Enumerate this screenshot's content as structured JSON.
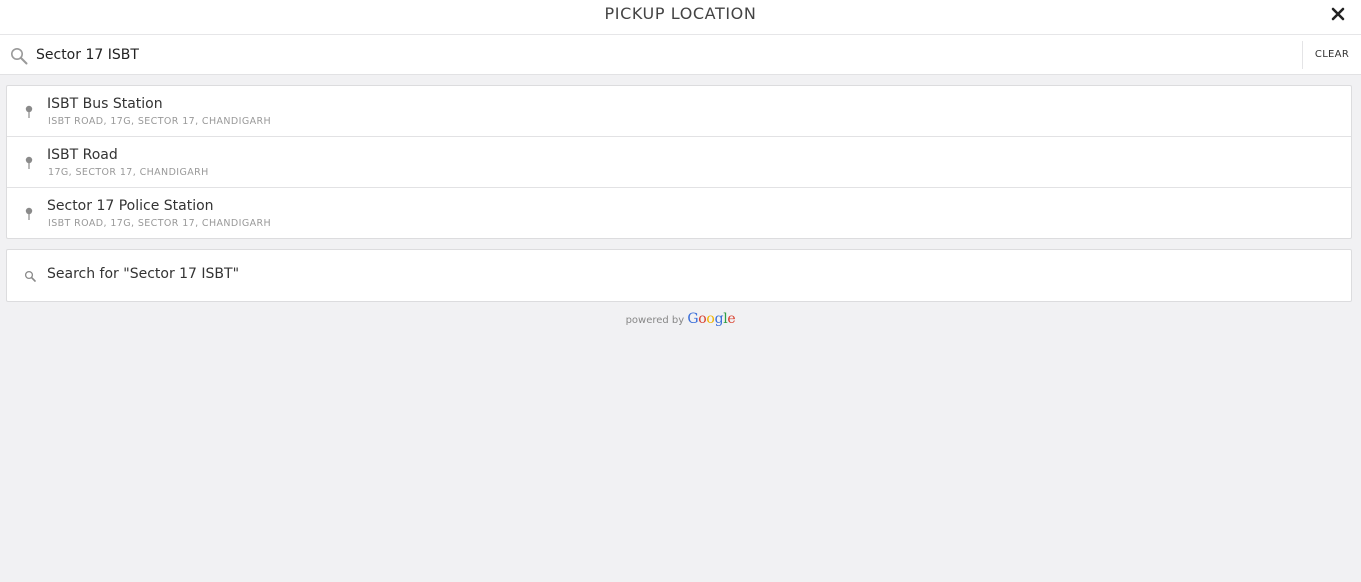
{
  "header": {
    "title": "PICKUP LOCATION",
    "close_icon": "close-icon"
  },
  "search": {
    "value": "Sector 17 ISBT",
    "icon": "search-icon",
    "clear_label": "CLEAR"
  },
  "results": [
    {
      "name": "ISBT Bus Station",
      "address": "ISBT ROAD, 17G, SECTOR 17, CHANDIGARH",
      "icon": "map-pin-icon"
    },
    {
      "name": "ISBT Road",
      "address": "17G, SECTOR 17, CHANDIGARH",
      "icon": "map-pin-icon"
    },
    {
      "name": "Sector 17 Police Station",
      "address": "ISBT ROAD, 17G, SECTOR 17, CHANDIGARH",
      "icon": "map-pin-icon"
    }
  ],
  "search_for": {
    "label": "Search for \"Sector 17 ISBT\"",
    "icon": "search-icon"
  },
  "attribution": {
    "prefix": "powered by",
    "brand_letters": [
      "G",
      "o",
      "o",
      "g",
      "l",
      "e"
    ]
  },
  "colors": {
    "background": "#f1f1f3",
    "panel": "#ffffff",
    "text": "#333333",
    "muted": "#999999"
  }
}
